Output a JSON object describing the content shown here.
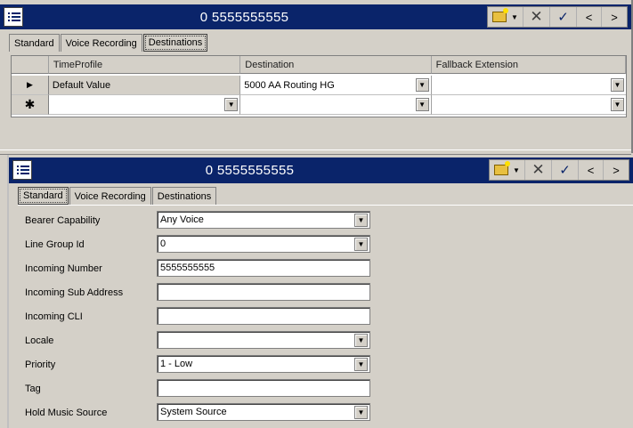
{
  "top_window": {
    "title": "0 5555555555",
    "tabs": [
      {
        "label": "Standard"
      },
      {
        "label": "Voice Recording"
      },
      {
        "label": "Destinations"
      }
    ],
    "active_tab": "Destinations",
    "table": {
      "columns": [
        "TimeProfile",
        "Destination",
        "Fallback Extension"
      ],
      "rows": [
        {
          "marker": "▶",
          "time_profile": "Default Value",
          "destination": "5000 AA Routing HG",
          "fallback": ""
        },
        {
          "marker": "✱",
          "time_profile": "",
          "destination": "",
          "fallback": ""
        }
      ]
    }
  },
  "bottom_window": {
    "title": "0 5555555555",
    "tabs": [
      {
        "label": "Standard"
      },
      {
        "label": "Voice Recording"
      },
      {
        "label": "Destinations"
      }
    ],
    "active_tab": "Standard",
    "fields": [
      {
        "label": "Bearer Capability",
        "value": "Any Voice",
        "type": "select"
      },
      {
        "label": "Line Group Id",
        "value": "0",
        "type": "select"
      },
      {
        "label": "Incoming Number",
        "value": "5555555555",
        "type": "text"
      },
      {
        "label": "Incoming Sub Address",
        "value": "",
        "type": "text"
      },
      {
        "label": "Incoming CLI",
        "value": "",
        "type": "text"
      },
      {
        "label": "Locale",
        "value": "",
        "type": "select"
      },
      {
        "label": "Priority",
        "value": "1 - Low",
        "type": "select"
      },
      {
        "label": "Tag",
        "value": "",
        "type": "text"
      },
      {
        "label": "Hold Music Source",
        "value": "System Source",
        "type": "select"
      }
    ]
  },
  "toolbar": {
    "icons": [
      "new-folder-icon",
      "close-icon",
      "check-icon",
      "previous-icon",
      "next-icon"
    ],
    "prev_glyph": "<",
    "next_glyph": ">"
  },
  "colors": {
    "titlebar": "#0a246a",
    "chrome": "#d4d0c8",
    "field_bg": "#ffffff"
  }
}
